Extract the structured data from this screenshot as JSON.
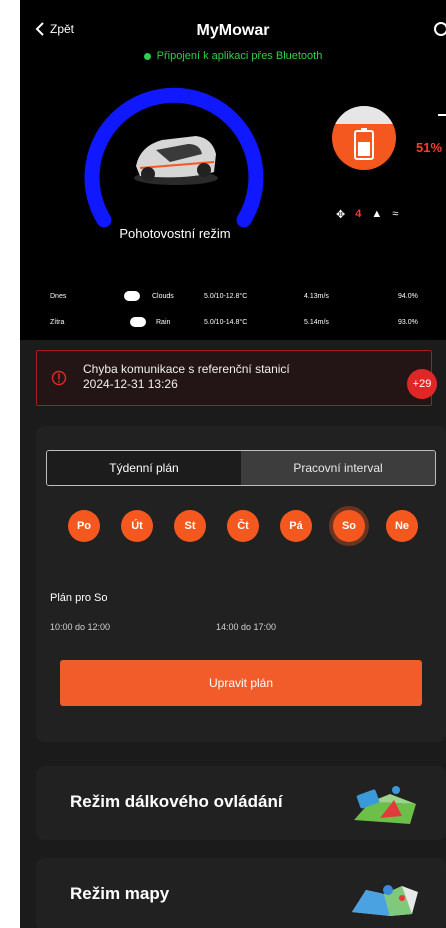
{
  "header": {
    "back_label": "Zpět",
    "title": "MyMowar",
    "bt_status": "Připojení k aplikaci přes Bluetooth"
  },
  "mower": {
    "mode": "Pohotovostní režim",
    "battery_percent": "51%",
    "status_alert_count": "4"
  },
  "weather": {
    "rows": [
      {
        "day": "Dnes",
        "condition": "Clouds",
        "temp": "5.0/10-12.8°C",
        "wind": "4.13m/s",
        "humidity": "94.0%"
      },
      {
        "day": "Zítra",
        "condition": "Rain",
        "temp": "5.0/10-14.8°C",
        "wind": "5.14m/s",
        "humidity": "93.0%"
      }
    ]
  },
  "alert": {
    "line1": "Chyba komunikace s referenční stanicí",
    "line2": "2024-12-31 13:26",
    "badge": "+29"
  },
  "schedule": {
    "tabs": [
      "Týdenní plán",
      "Pracovní interval"
    ],
    "days": [
      "Po",
      "Út",
      "St",
      "Čt",
      "Pá",
      "So",
      "Ne"
    ],
    "selected_day": "So",
    "plan_title": "Plán pro So",
    "slot1": "10:00 do 12:00",
    "slot2": "14:00 do 17:00",
    "edit_label": "Upravit plán"
  },
  "modes": {
    "remote": "Režim dálkového ovládání",
    "map": "Režim mapy"
  },
  "colors": {
    "accent": "#f4581f",
    "gauge": "#1018ff",
    "bluetooth": "#2fd04a",
    "alert": "#e02626"
  }
}
